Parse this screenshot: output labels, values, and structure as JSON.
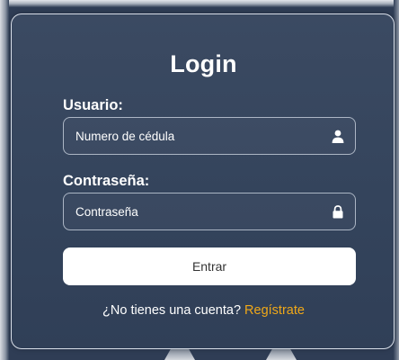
{
  "login": {
    "title": "Login",
    "username": {
      "label": "Usuario:",
      "placeholder": "Numero de cédula",
      "value": ""
    },
    "password": {
      "label": "Contraseña:",
      "placeholder": "Contraseña",
      "value": ""
    },
    "submit_label": "Entrar",
    "signup_prompt": "¿No tienes una cuenta?",
    "signup_link": "Regístrate"
  },
  "icons": {
    "username": "user-icon",
    "password": "lock-icon"
  },
  "colors": {
    "background": "#2f3d55",
    "card": "#3b4a62",
    "accent_link": "#f0a818",
    "button": "#ffffff"
  }
}
